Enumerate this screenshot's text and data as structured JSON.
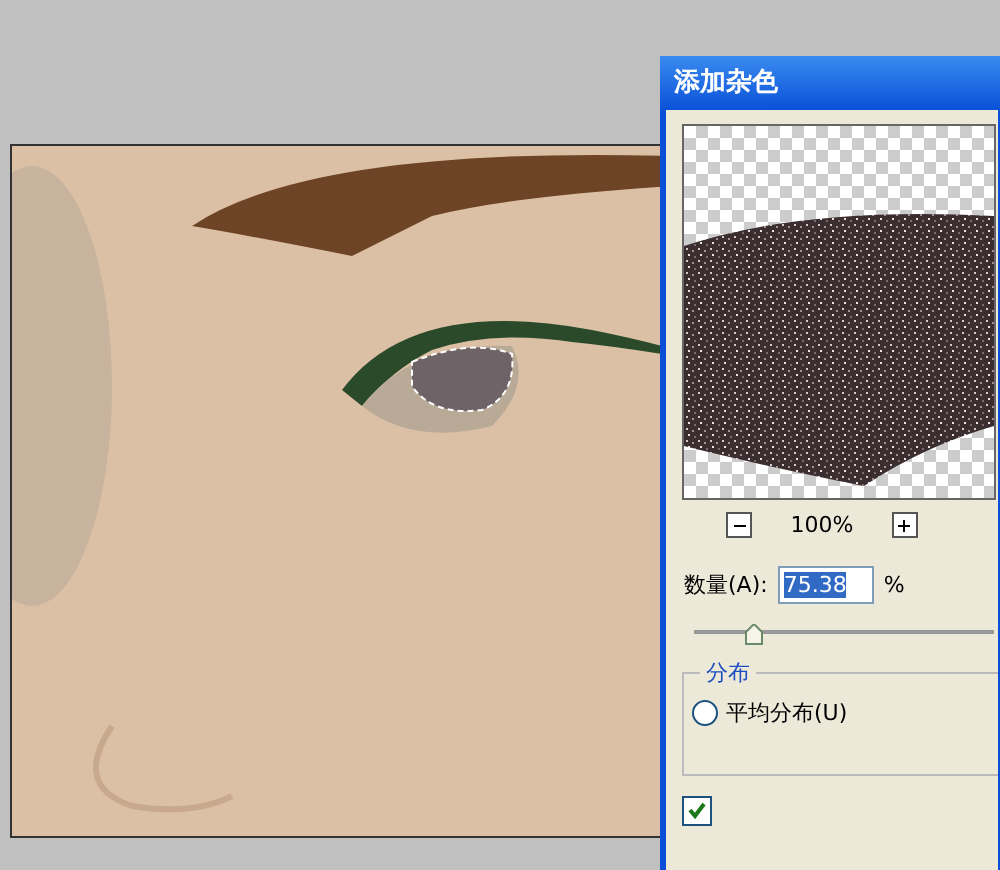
{
  "dialog": {
    "title": "添加杂色",
    "preview": {
      "zoom": "100%"
    },
    "amount": {
      "label": "数量(A):",
      "value": "75.38",
      "unit": "%",
      "level": 0.2
    },
    "distribution": {
      "title": "分布",
      "options": [
        {
          "label": "平均分布(U)",
          "selected": false
        }
      ]
    },
    "monochrome": {
      "checked": true
    }
  }
}
